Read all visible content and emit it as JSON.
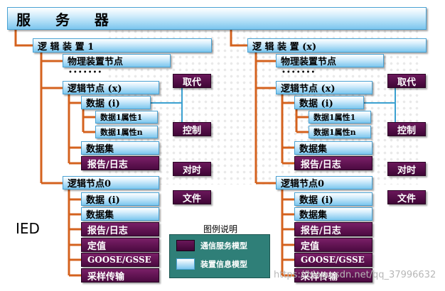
{
  "title": "服  务  器",
  "ied_label": "IED",
  "left": {
    "logical_device": "逻 辑 装 置 1",
    "physical_node": "物理装置节点",
    "dots": "•••••••",
    "ln_x": "逻辑节点 (x)",
    "data_i": "数据 (i)",
    "attr1": "数据1属性1",
    "attrn": "数据1属性n",
    "dataset": "数据集",
    "report_log": "报告/日志",
    "ln0": "逻辑节点0",
    "ln0_data": "数据 (i)",
    "ln0_dataset": "数据集",
    "ln0_report": "报告/日志",
    "setting": "定值",
    "goose": "GOOSE/GSSE",
    "sampling": "采样传输"
  },
  "right": {
    "logical_device": "逻 辑 装 置 (x)",
    "physical_node": "物理装置节点",
    "dots": "•••••••",
    "ln_x": "逻辑节点 (x)",
    "data_i": "数据 (i)",
    "attr1": "数据1属性1",
    "attrn": "数据1属性n",
    "dataset": "数据集",
    "report_log": "报告/日志",
    "ln0": "逻辑节点0",
    "ln0_data": "数据 (i)",
    "ln0_dataset": "数据集",
    "ln0_report": "报告/日志",
    "setting": "定值",
    "goose": "GOOSE/GSSE",
    "sampling": "采样传输"
  },
  "services": {
    "substitute": "取代",
    "control": "控制",
    "time_sync": "对时",
    "file": "文件"
  },
  "legend": {
    "title": "图例说明",
    "comm_service": "通信服务模型",
    "device_info": "装置信息模型"
  },
  "watermark": "https://blog.csdn.net/qq_37996632",
  "colors": {
    "connector": "#d4621e",
    "service": "#4b0a40",
    "info": "#7cc6ee"
  }
}
